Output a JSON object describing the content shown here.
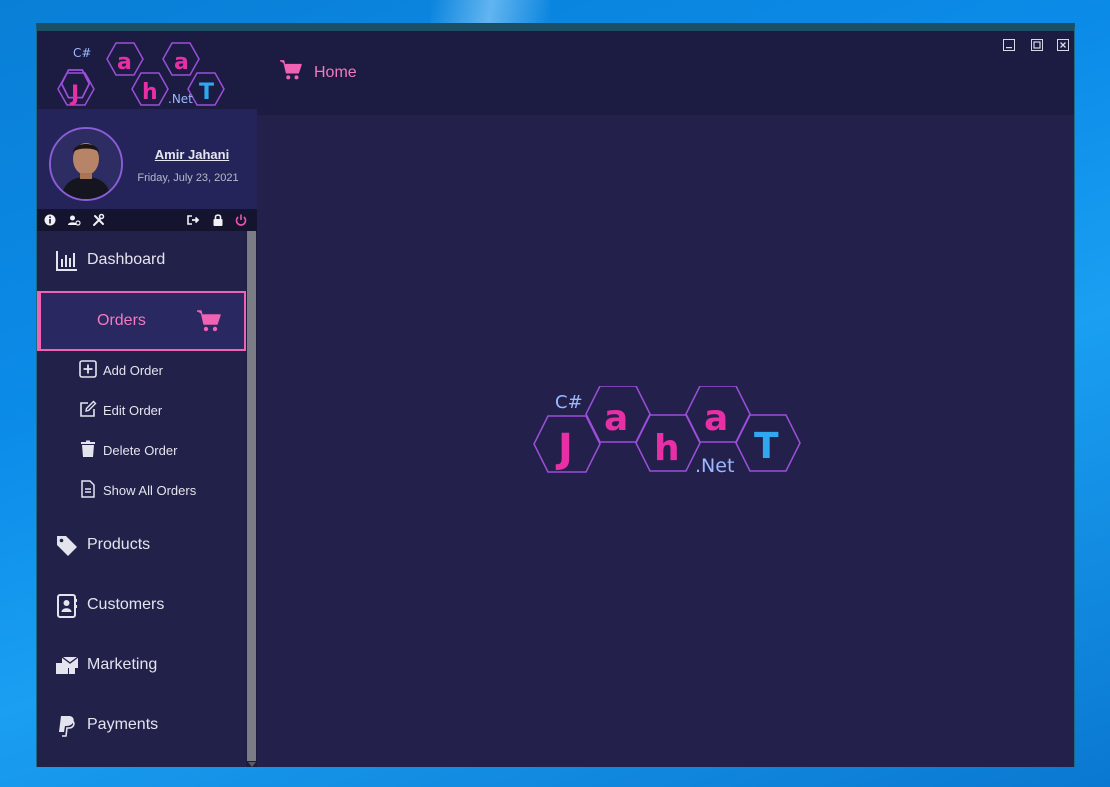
{
  "app": {
    "logo_text": {
      "csharp": "C#",
      "j": "J",
      "a1": "a",
      "h": "h",
      "a2": "a",
      "t": "T",
      "net": ".Net"
    }
  },
  "profile": {
    "name": "Amir Jahani",
    "date": "Friday, July 23, 2021"
  },
  "toolbar": {
    "icons": [
      "info-icon",
      "user-settings-icon",
      "tools-icon",
      "sign-out-icon",
      "lock-icon",
      "power-icon"
    ]
  },
  "menu": {
    "dashboard": "Dashboard",
    "orders": "Orders",
    "sub_items": [
      "Add Order",
      "Edit Order",
      "Delete Order",
      "Show All Orders"
    ],
    "products": "Products",
    "customers": "Customers",
    "marketing": "Marketing",
    "payments": "Payments"
  },
  "header": {
    "title": "Home"
  },
  "colors": {
    "accent_pink": "#f062b4",
    "hex_outline": "#9b4fd9",
    "logo_blue": "#2fa8f0",
    "background": "#22214a"
  }
}
